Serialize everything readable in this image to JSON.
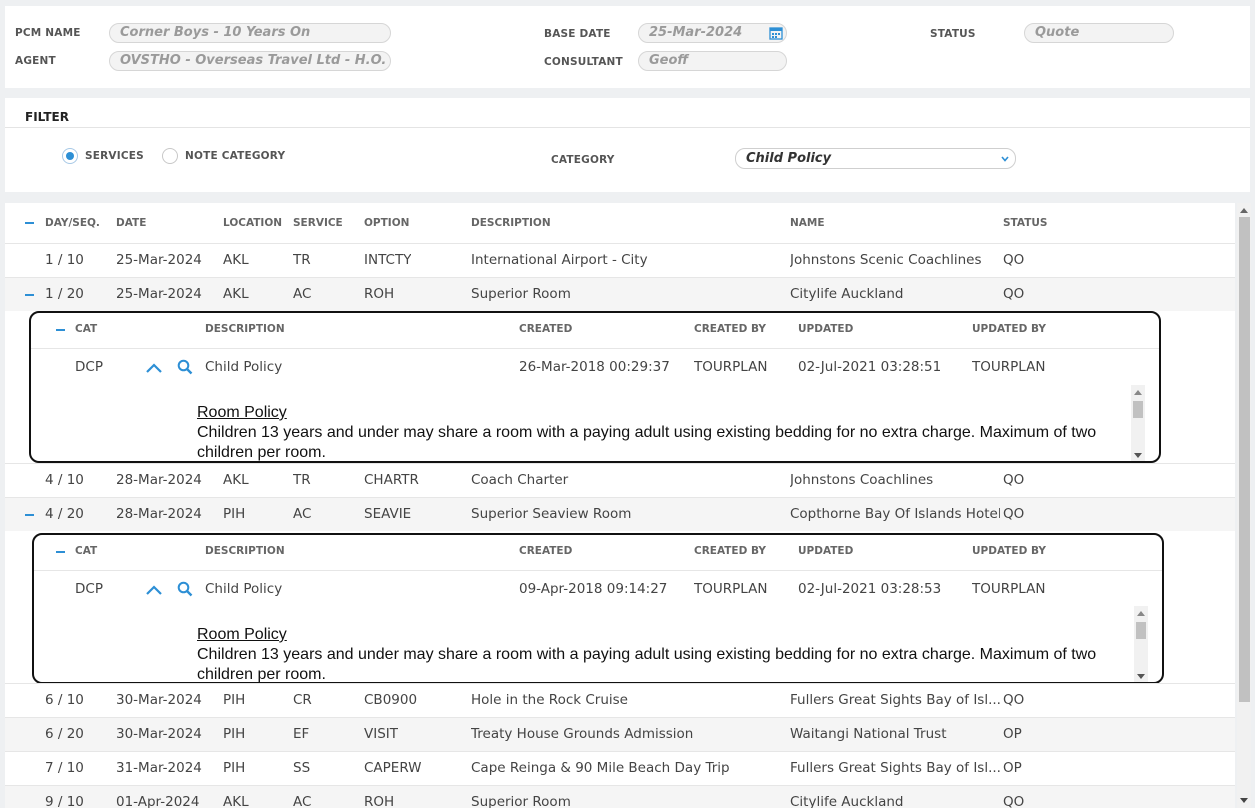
{
  "header": {
    "pcm_name_label": "PCM NAME",
    "pcm_name": "Corner Boys - 10 Years On",
    "agent_label": "AGENT",
    "agent": "OVSTHO - Overseas Travel Ltd - H.O.",
    "base_date_label": "BASE DATE",
    "base_date": "25-Mar-2024",
    "consultant_label": "CONSULTANT",
    "consultant": "Geoff",
    "status_label": "STATUS",
    "status": "Quote"
  },
  "filter": {
    "title": "FILTER",
    "services_label": "SERVICES",
    "note_category_label": "NOTE CATEGORY",
    "category_label": "CATEGORY",
    "category_value": "Child Policy"
  },
  "grid": {
    "columns": {
      "dayseq": "DAY/SEQ.",
      "date": "DATE",
      "location": "LOCATION",
      "service": "SERVICE",
      "option": "OPTION",
      "description": "DESCRIPTION",
      "name": "NAME",
      "status": "STATUS"
    },
    "rows": [
      {
        "dayseq": "1 / 10",
        "date": "25-Mar-2024",
        "location": "AKL",
        "service": "TR",
        "option": "INTCTY",
        "description": "International Airport - City",
        "name": "Johnstons Scenic Coachlines",
        "status": "QO"
      },
      {
        "dayseq": "1 / 20",
        "date": "25-Mar-2024",
        "location": "AKL",
        "service": "AC",
        "option": "ROH",
        "description": "Superior Room",
        "name": "Citylife Auckland",
        "status": "QO"
      },
      {
        "dayseq": "4 / 10",
        "date": "28-Mar-2024",
        "location": "AKL",
        "service": "TR",
        "option": "CHARTR",
        "description": "Coach Charter",
        "name": "Johnstons Coachlines",
        "status": "QO"
      },
      {
        "dayseq": "4 / 20",
        "date": "28-Mar-2024",
        "location": "PIH",
        "service": "AC",
        "option": "SEAVIE",
        "description": "Superior Seaview Room",
        "name": "Copthorne Bay Of Islands Hotel",
        "status": "QO"
      },
      {
        "dayseq": "6 / 10",
        "date": "30-Mar-2024",
        "location": "PIH",
        "service": "CR",
        "option": "CB0900",
        "description": "Hole in the Rock Cruise",
        "name": "Fullers Great Sights Bay of Isl...",
        "status": "QO"
      },
      {
        "dayseq": "6 / 20",
        "date": "30-Mar-2024",
        "location": "PIH",
        "service": "EF",
        "option": "VISIT",
        "description": "Treaty House Grounds Admission",
        "name": "Waitangi National Trust",
        "status": "OP"
      },
      {
        "dayseq": "7 / 10",
        "date": "31-Mar-2024",
        "location": "PIH",
        "service": "SS",
        "option": "CAPERW",
        "description": "Cape Reinga & 90 Mile Beach Day Trip",
        "name": "Fullers Great Sights Bay of Isl...",
        "status": "OP"
      },
      {
        "dayseq": "9 / 10",
        "date": "01-Apr-2024",
        "location": "AKL",
        "service": "AC",
        "option": "ROH",
        "description": "Superior Room",
        "name": "Citylife Auckland",
        "status": "QO"
      }
    ]
  },
  "notes": {
    "columns": {
      "cat": "CAT",
      "description": "DESCRIPTION",
      "created": "CREATED",
      "created_by": "CREATED BY",
      "updated": "UPDATED",
      "updated_by": "UPDATED BY"
    },
    "items": [
      {
        "cat": "DCP",
        "description": "Child Policy",
        "created": "26-Mar-2018 00:29:37",
        "created_by": "TOURPLAN",
        "updated": "02-Jul-2021 03:28:51",
        "updated_by": "TOURPLAN",
        "note_title": "Room Policy",
        "note_text": "Children 13 years and under may share a room with a paying adult using existing bedding for no extra charge. Maximum of two children per room."
      },
      {
        "cat": "DCP",
        "description": "Child Policy",
        "created": "09-Apr-2018 09:14:27",
        "created_by": "TOURPLAN",
        "updated": "02-Jul-2021 03:28:53",
        "updated_by": "TOURPLAN",
        "note_title": "Room Policy",
        "note_text": "Children 13 years and under may share a room with a paying adult using existing bedding for no extra charge. Maximum of two children per room."
      }
    ]
  },
  "icons": {
    "calendar": "calendar-icon",
    "collapse": "minus-icon",
    "expand_up": "chevron-up-icon",
    "search": "search-icon",
    "dropdown": "chevron-down-icon"
  },
  "colors": {
    "accent": "#2d8fd5"
  }
}
